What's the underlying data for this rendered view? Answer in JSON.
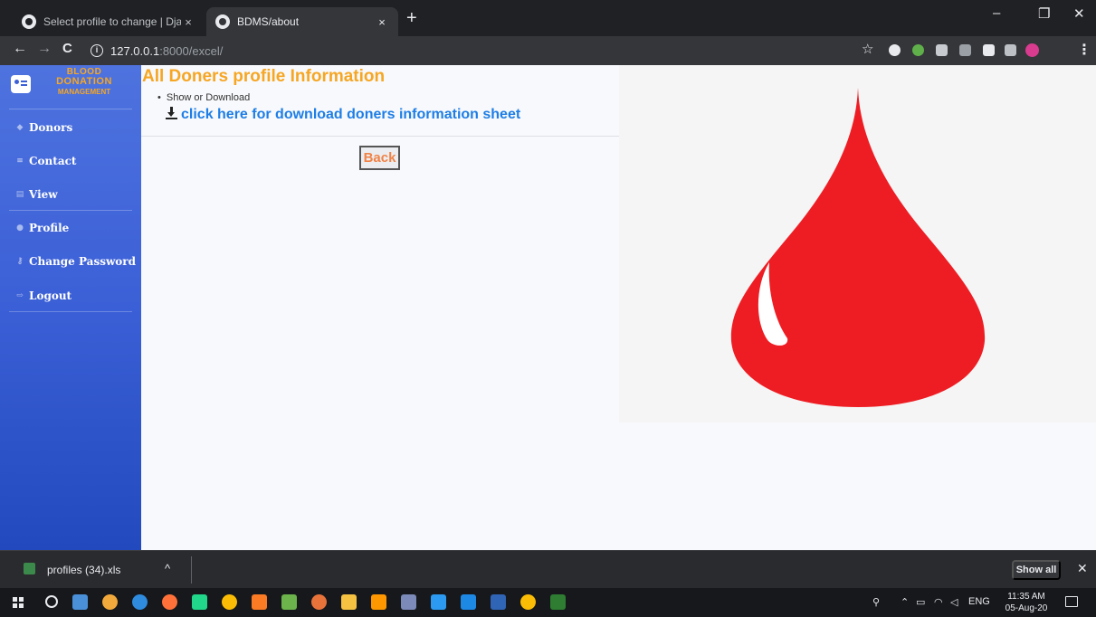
{
  "browser": {
    "tabs": [
      {
        "title": "Select profile to change | Django",
        "close": "×"
      },
      {
        "title": "BDMS/about",
        "close": "×"
      }
    ],
    "new_tab": "+",
    "window_controls": {
      "minimize": "–",
      "restore": "❐",
      "close": "✕"
    },
    "nav": {
      "back": "←",
      "forward": "→",
      "reload": "C"
    },
    "address": {
      "host": "127.0.0.1",
      "path": ":8000/excel/"
    },
    "star": "☆"
  },
  "sidebar": {
    "brand": {
      "line1": "BLOOD",
      "line2": "DONATION",
      "line3": "MANAGEMENT"
    },
    "items": [
      {
        "label": "Donors",
        "icon": "users-icon"
      },
      {
        "label": "Contact",
        "icon": "list-icon"
      },
      {
        "label": "View",
        "icon": "table-icon"
      },
      {
        "label": "Profile",
        "icon": "user-icon"
      },
      {
        "label": "Change Password",
        "icon": "key-icon"
      },
      {
        "label": "Logout",
        "icon": "logout-icon"
      }
    ]
  },
  "main": {
    "title": "All Doners profile Information",
    "bullet": "Show or Download",
    "download_link": "click here for download doners information sheet",
    "back_button": "Back"
  },
  "colors": {
    "sidebar_top": "#4e73df",
    "sidebar_bottom": "#224abe",
    "title_orange": "#f6a623",
    "link_blue": "#1e7ee6",
    "back_orange": "#f08346",
    "drop_red": "#ee1d23"
  },
  "download_bar": {
    "file_name": "profiles (34).xls",
    "chevron": "^",
    "show_all": "Show all",
    "close": "✕"
  },
  "taskbar": {
    "language": "ENG",
    "time": "11:35 AM",
    "date": "05-Aug-20"
  }
}
